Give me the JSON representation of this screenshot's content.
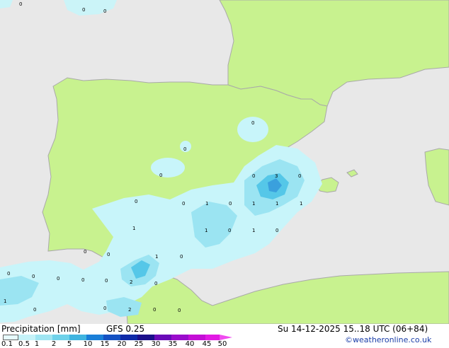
{
  "colors": {
    "sea": "#e8e8e8",
    "land": "#c8f28f",
    "coast": "#a9a9a9",
    "precip_light": "#c8f5fa",
    "precip_mid": "#9be4f2",
    "precip_heavy": "#55c7e8",
    "precip_core": "#3aa0dd",
    "credit": "#1a3ea8"
  },
  "footer": {
    "title": "Precipitation [mm]",
    "model": "GFS 0.25",
    "datetime": "Su 14-12-2025 15..18 UTC (06+84)",
    "credit": "©weatheronline.co.uk"
  },
  "legend": {
    "labels": [
      "0.1",
      "0.5",
      "1",
      "2",
      "5",
      "10",
      "15",
      "20",
      "25",
      "30",
      "35",
      "40",
      "45",
      "50"
    ],
    "colors": [
      "#e6fafd",
      "#c5f2f8",
      "#9fe5f2",
      "#6fd2ea",
      "#3fb4e0",
      "#1a7fd8",
      "#1451c2",
      "#0e2aa8",
      "#1a0f8a",
      "#6a0ab8",
      "#9a0ccc",
      "#c40fd6",
      "#e21ae4",
      "#f04cf0"
    ]
  },
  "map_labels": [
    "0",
    "0",
    "0",
    "0",
    "0",
    "0",
    "0",
    "3",
    "0",
    "0",
    "0",
    "1",
    "0",
    "1",
    "1",
    "1",
    "1",
    "1",
    "0",
    "1",
    "0",
    "0",
    "0",
    "1",
    "0",
    "0",
    "0",
    "0",
    "0",
    "2",
    "0",
    "0",
    "1",
    "0",
    "2",
    "0",
    "0",
    "0"
  ]
}
